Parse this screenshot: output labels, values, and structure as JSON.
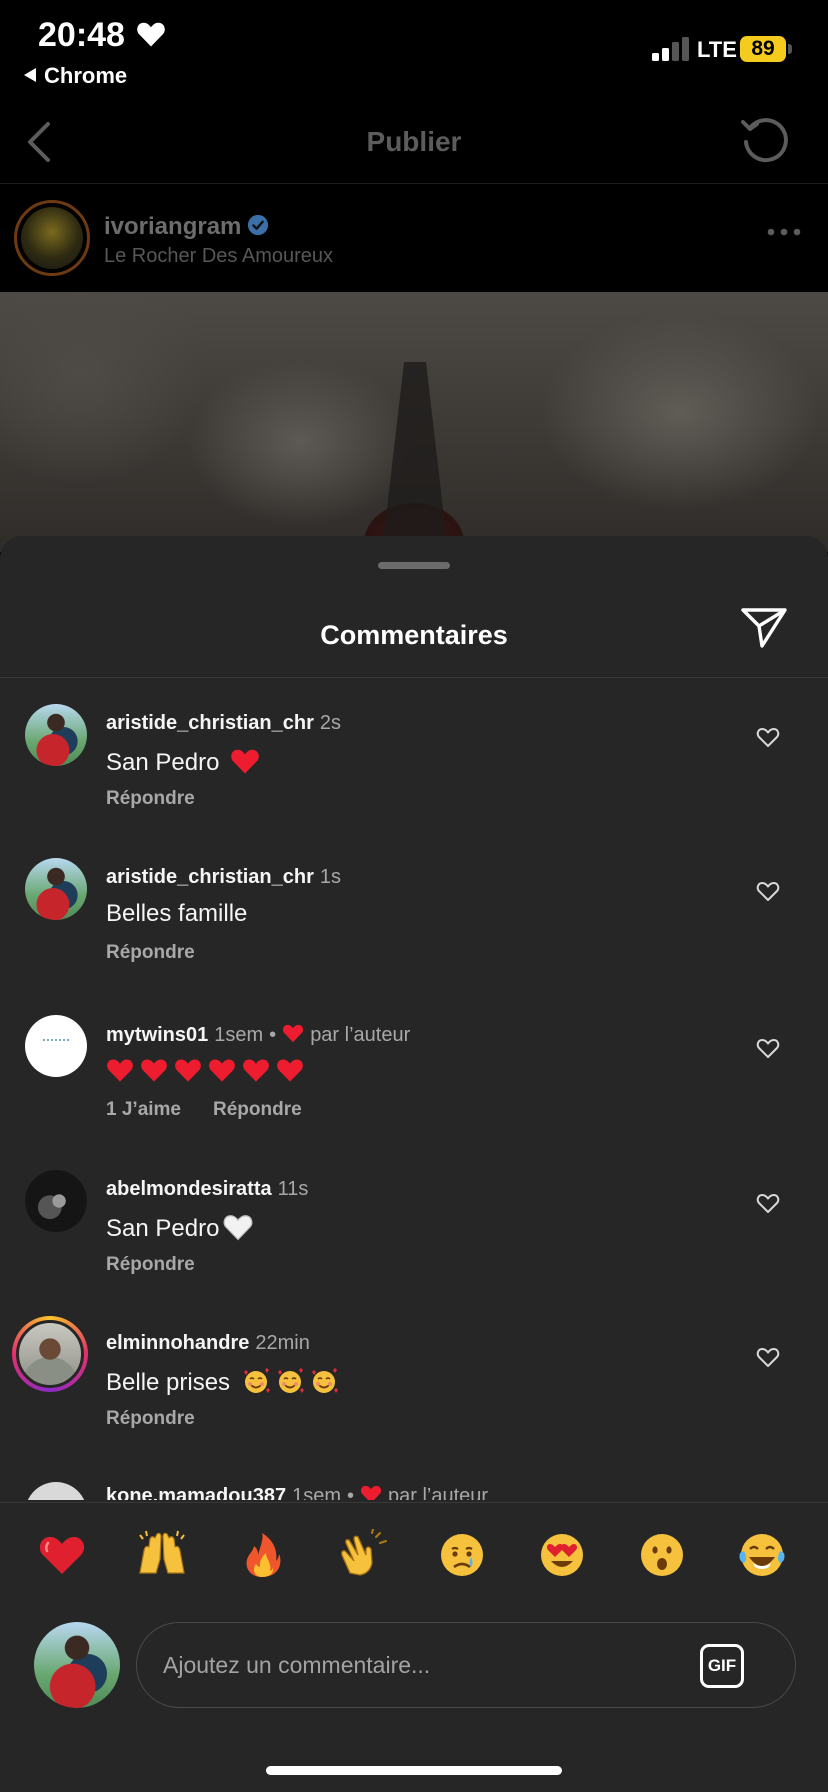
{
  "status_bar": {
    "time": "20:48",
    "back_app": "Chrome",
    "network": "LTE",
    "battery": "89"
  },
  "app_bar": {
    "title": "Publier",
    "icons": [
      "chevron-left-icon",
      "refresh-icon"
    ]
  },
  "post": {
    "username": "ivoriangram",
    "location": "Le Rocher Des Amoureux",
    "verified": true
  },
  "sheet": {
    "title": "Commentaires",
    "comments": [
      {
        "username": "aristide_christian_chr",
        "time": "2s",
        "text": "San Pedro",
        "text_emoji": "red-heart",
        "liked_by_author": false,
        "likes": "",
        "reply": "Répondre"
      },
      {
        "username": "aristide_christian_chr",
        "time": "1s",
        "text": "Belles famille",
        "liked_by_author": false,
        "likes": "",
        "reply": "Répondre"
      },
      {
        "username": "mytwins01",
        "time": "1sem",
        "liked_by_author": true,
        "by_author": "par l’auteur",
        "hearts_count": 6,
        "likes": "1 J’aime",
        "reply": "Répondre"
      },
      {
        "username": "abelmondesiratta",
        "time": "11s",
        "text": "San Pedro",
        "text_emoji": "white-heart",
        "liked_by_author": false,
        "likes": "",
        "reply": "Répondre"
      },
      {
        "username": "elminnohandre",
        "time": "22min",
        "text": "Belle prises",
        "text_emoji": "smiling-face-with-hearts x3",
        "liked_by_author": false,
        "likes": "",
        "reply": "Répondre"
      },
      {
        "username": "kone.mamadou387",
        "time": "1sem",
        "liked_by_author": true,
        "by_author": "par l’auteur"
      }
    ]
  },
  "reactions": [
    "red-heart",
    "raising-hands",
    "fire",
    "clapping-hands",
    "crying-face",
    "heart-eyes",
    "surprised-face",
    "tears-of-joy"
  ],
  "composer": {
    "placeholder": "Ajoutez un commentaire...",
    "gif_label": "GIF"
  },
  "colors": {
    "sheet_bg": "#262626",
    "muted_text": "#a8a8a8",
    "heart_red": "#ed1c2e",
    "battery": "#f5cc1d"
  }
}
